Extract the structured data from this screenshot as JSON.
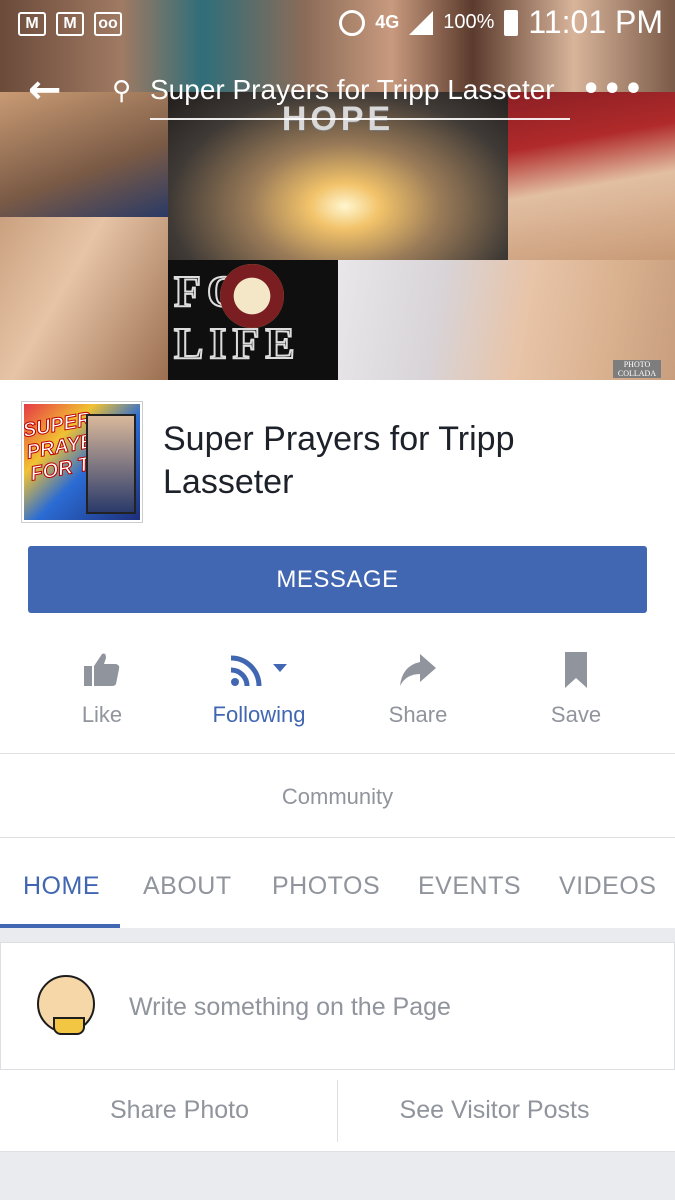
{
  "status_bar": {
    "left_icons": [
      "gmail-icon",
      "gmail-icon",
      "voicemail-icon"
    ],
    "network": "4G",
    "network_sub": "LTE",
    "battery": "100%",
    "time": "11:01 PM"
  },
  "toolbar": {
    "title": "Super Prayers for Tripp Lasseter"
  },
  "cover": {
    "hope_text": "HOPE",
    "forlife_text": "FOR LIFE",
    "badge_text": "PHOTO COLLADA"
  },
  "profile": {
    "image_text": "SUPER PRAYERS FOR TRIPP"
  },
  "page": {
    "name": "Super Prayers for Tripp Lasseter",
    "category": "Community"
  },
  "message_button": "MESSAGE",
  "actions": {
    "like": "Like",
    "following": "Following",
    "share": "Share",
    "save": "Save"
  },
  "tabs": [
    "HOME",
    "ABOUT",
    "PHOTOS",
    "EVENTS",
    "VIDEOS"
  ],
  "active_tab": "HOME",
  "composer": {
    "placeholder": "Write something on the Page",
    "share_photo": "Share Photo",
    "see_visitor_posts": "See Visitor Posts"
  },
  "colors": {
    "brand": "#4267b2",
    "muted_text": "#90949c",
    "divider": "#dddfe2"
  }
}
